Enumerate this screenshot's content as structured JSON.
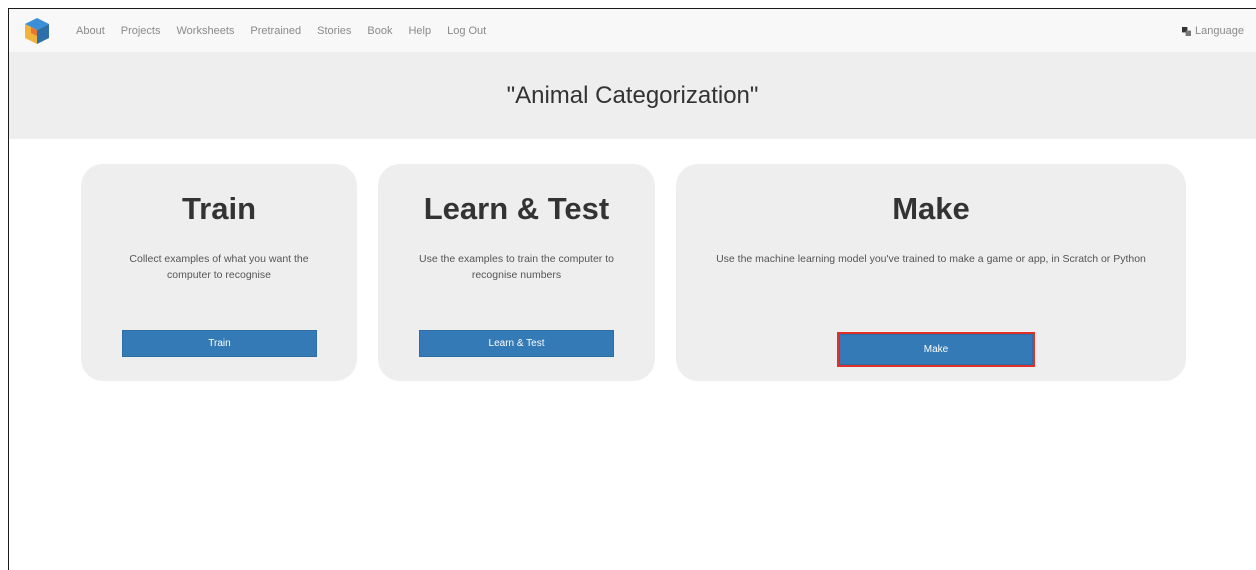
{
  "nav": {
    "links": [
      "About",
      "Projects",
      "Worksheets",
      "Pretrained",
      "Stories",
      "Book",
      "Help",
      "Log Out"
    ],
    "language_label": "Language"
  },
  "project": {
    "title": "\"Animal Categorization\""
  },
  "cards": {
    "train": {
      "title": "Train",
      "description": "Collect examples of what you want the computer to recognise",
      "button_label": "Train"
    },
    "learn": {
      "title": "Learn & Test",
      "description": "Use the examples to train the computer to recognise numbers",
      "button_label": "Learn & Test"
    },
    "make": {
      "title": "Make",
      "description": "Use the machine learning model you've trained to make a game or app, in Scratch or Python",
      "button_label": "Make"
    }
  },
  "colors": {
    "button_primary": "#337ab7",
    "highlight_outline": "#e0302a",
    "card_bg": "#eeeeee"
  },
  "icons": {
    "logo": "cube-logo-icon",
    "language": "translate-icon"
  }
}
